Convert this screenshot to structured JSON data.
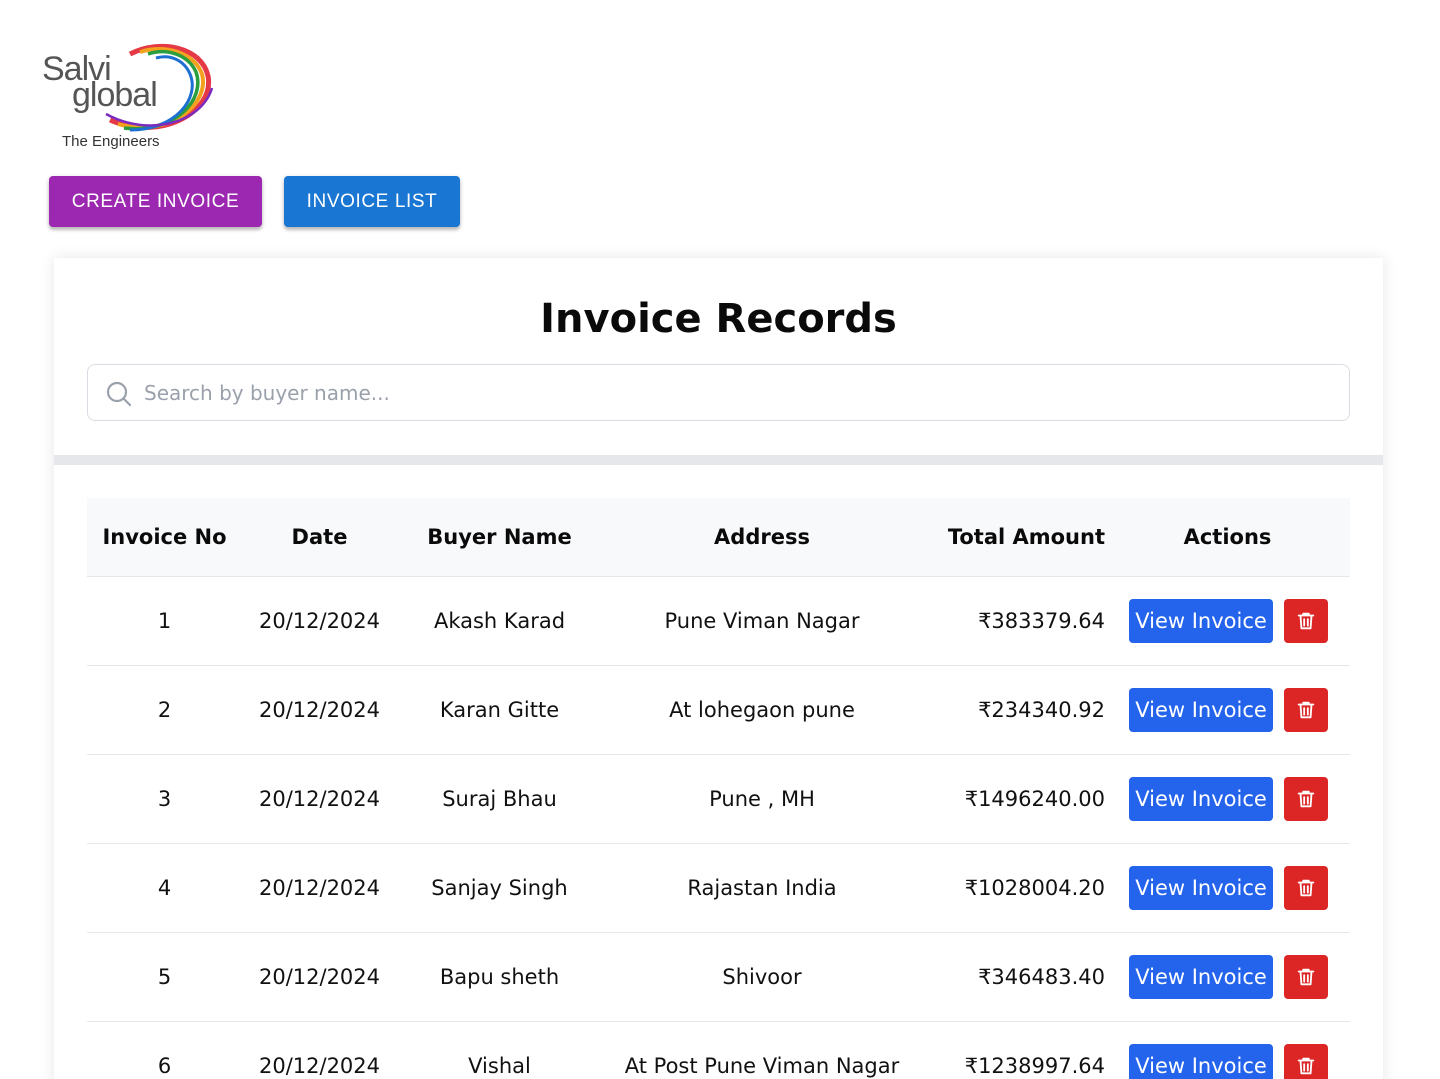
{
  "brand": {
    "line1": "Salvi",
    "line2": "global",
    "tagline": "The Engineers"
  },
  "nav": {
    "create_label": "CREATE INVOICE",
    "list_label": "INVOICE LIST"
  },
  "colors": {
    "create": "#9c27b0",
    "list": "#1976d2",
    "view": "#2463eb",
    "delete": "#dc2626"
  },
  "page": {
    "title": "Invoice Records"
  },
  "search": {
    "placeholder": "Search by buyer name...",
    "icon": "search-icon"
  },
  "table": {
    "headers": [
      "Invoice No",
      "Date",
      "Buyer Name",
      "Address",
      "Total Amount",
      "Actions"
    ],
    "view_label": "View Invoice",
    "delete_icon": "trash-icon",
    "rows": [
      {
        "no": "1",
        "date": "20/12/2024",
        "buyer": "Akash Karad",
        "address": "Pune Viman Nagar",
        "amount": "₹383379.64"
      },
      {
        "no": "2",
        "date": "20/12/2024",
        "buyer": "Karan Gitte",
        "address": "At lohegaon pune",
        "amount": "₹234340.92"
      },
      {
        "no": "3",
        "date": "20/12/2024",
        "buyer": "Suraj Bhau",
        "address": "Pune , MH",
        "amount": "₹1496240.00"
      },
      {
        "no": "4",
        "date": "20/12/2024",
        "buyer": "Sanjay Singh",
        "address": "Rajastan India",
        "amount": "₹1028004.20"
      },
      {
        "no": "5",
        "date": "20/12/2024",
        "buyer": "Bapu sheth",
        "address": "Shivoor",
        "amount": "₹346483.40"
      },
      {
        "no": "6",
        "date": "20/12/2024",
        "buyer": "Vishal",
        "address": "At Post Pune Viman Nagar",
        "amount": "₹1238997.64"
      }
    ]
  }
}
